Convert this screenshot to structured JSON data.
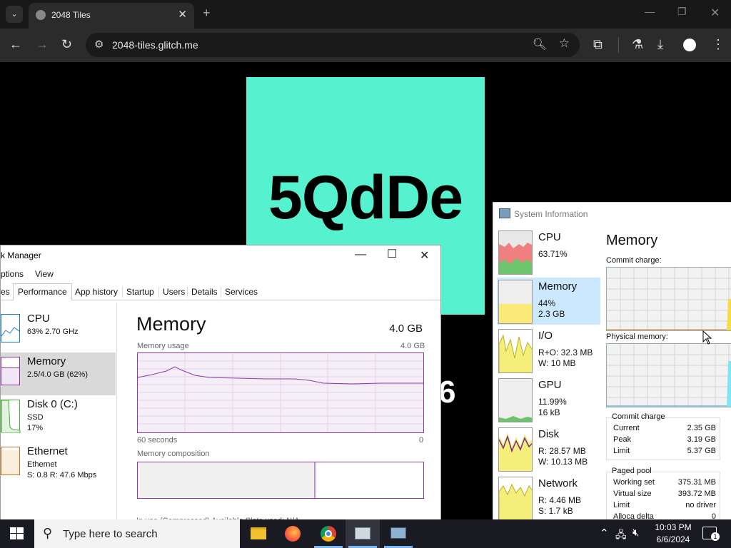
{
  "browser": {
    "tab_title": "2048 Tiles",
    "url": "2048-tiles.glitch.me"
  },
  "page": {
    "captcha_text": "5QdDe",
    "partial_digit": "6"
  },
  "task_manager": {
    "title_partial": "k Manager",
    "menu": [
      "ptions",
      "View"
    ],
    "tabs": [
      "es",
      "Performance",
      "App history",
      "Startup",
      "Users",
      "Details",
      "Services"
    ],
    "active_tab": "Performance",
    "side": [
      {
        "name": "CPU",
        "line1": "63%  2.70 GHz",
        "line2": "",
        "color": "#1a7fc8"
      },
      {
        "name": "Memory",
        "line1": "2.5/4.0 GB (62%)",
        "line2": "",
        "color": "#8b3aa8"
      },
      {
        "name": "Disk 0 (C:)",
        "line1": "SSD",
        "line2": "17%",
        "color": "#4ca83e"
      },
      {
        "name": "Ethernet",
        "line1": "Ethernet",
        "line2": "S: 0.8  R: 47.6 Mbps",
        "color": "#b8741e"
      }
    ],
    "main": {
      "title": "Memory",
      "total": "4.0 GB",
      "usage_label": "Memory usage",
      "usage_max": "4.0 GB",
      "axis_left": "60 seconds",
      "axis_right": "0",
      "composition_label": "Memory composition",
      "footer_partial": "In use (Compressed)      Available      Slots used:      N/A"
    }
  },
  "system_info": {
    "title": "System Information",
    "side": [
      {
        "name": "CPU",
        "line1": "63.71%",
        "line2": ""
      },
      {
        "name": "Memory",
        "line1": "44%",
        "line2": "2.3 GB"
      },
      {
        "name": "I/O",
        "line1": "R+O: 32.3 MB",
        "line2": "W: 10 MB"
      },
      {
        "name": "GPU",
        "line1": "11.99%",
        "line2": "16 kB"
      },
      {
        "name": "Disk",
        "line1": "R: 28.57 MB",
        "line2": "W: 10.13 MB"
      },
      {
        "name": "Network",
        "line1": "R: 4.46 MB",
        "line2": "S: 1.7 kB"
      }
    ],
    "main_title": "Memory",
    "commit_graph_label": "Commit charge:",
    "physical_graph_label": "Physical memory:",
    "commit_box": {
      "title": "Commit charge",
      "rows": [
        {
          "k": "Current",
          "v": "2.35 GB"
        },
        {
          "k": "Peak",
          "v": "3.19 GB"
        },
        {
          "k": "Limit",
          "v": "5.37 GB"
        }
      ]
    },
    "paged_box": {
      "title": "Paged pool",
      "rows": [
        {
          "k": "Working set",
          "v": "375.31 MB"
        },
        {
          "k": "Virtual size",
          "v": "393.72 MB"
        },
        {
          "k": "Limit",
          "v": "no driver"
        },
        {
          "k": "Alloca delta",
          "v": "0"
        }
      ]
    }
  },
  "taskbar": {
    "search_placeholder": "Type here to search",
    "time": "10:03 PM",
    "date": "6/6/2024",
    "notification_count": "1"
  },
  "colors": {
    "captcha_bg": "#56f2cf",
    "tm_memory": "#8b3aa8",
    "si_selected": "#cce8ff"
  }
}
